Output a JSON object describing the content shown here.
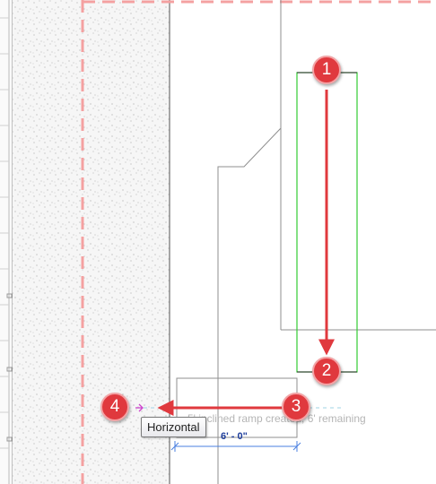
{
  "drawing": {
    "tooltip_label": "Horizontal",
    "status_text": "5' inclined ramp created, 6' remaining",
    "dimension_label": "6' - 0\""
  },
  "callouts": [
    "1",
    "2",
    "3",
    "4"
  ],
  "colors": {
    "callout": "#e0393e",
    "boundary_dash": "#f4a1a1",
    "ramp_outline": "#33cc33",
    "dimension": "#4a7fe0",
    "alignment_guide": "#9fd3e6",
    "snap_marker": "#cc44cc",
    "hatch_fill": "#f4f4f4"
  }
}
